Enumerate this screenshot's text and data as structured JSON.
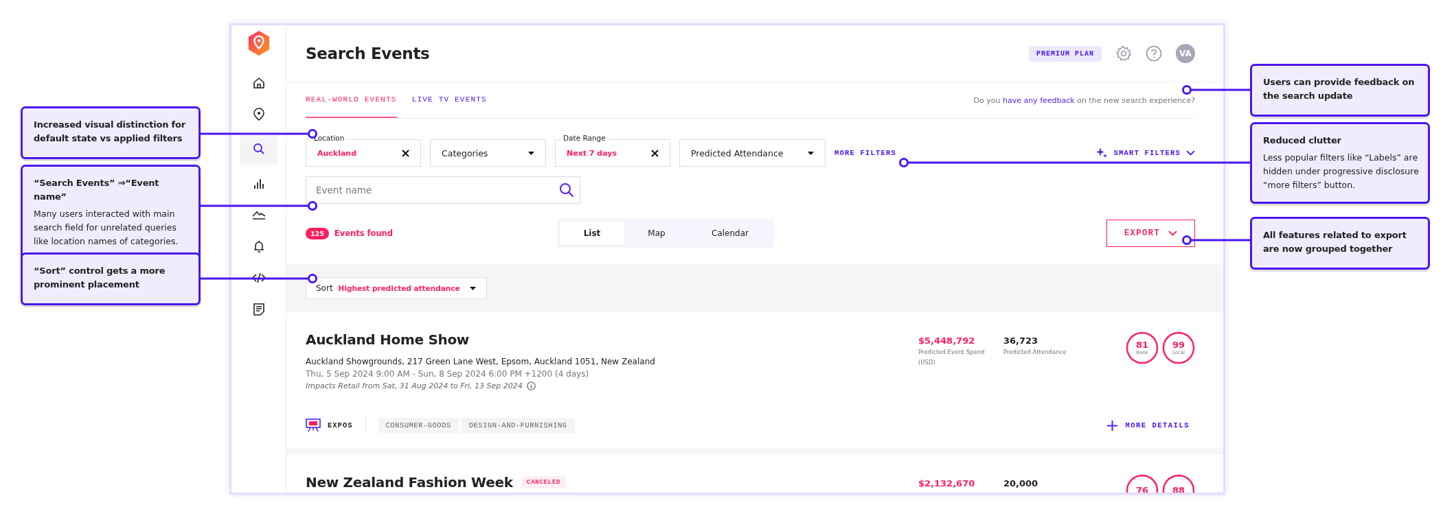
{
  "annotations": {
    "left": [
      {
        "title": "Increased visual distinction for default state vs applied filters"
      },
      {
        "title": "“Search Events” ⇒“Event name”",
        "body": "Many users interacted with main search field for unrelated queries like location names of categories."
      },
      {
        "title": "“Sort” control gets a more prominent placement"
      }
    ],
    "right": [
      {
        "title": "Users can provide feedback on the search update"
      },
      {
        "title": "Reduced clutter",
        "body": "Less popular filters like “Labels” are hidden under progressive disclosure “more filters” button."
      },
      {
        "title": "All features related to export are now grouped together"
      }
    ]
  },
  "sidebar": {
    "items": [
      {
        "selected": false
      },
      {
        "selected": false
      },
      {
        "selected": true
      },
      {
        "selected": false
      },
      {
        "selected": false
      },
      {
        "selected": false
      },
      {
        "selected": false
      },
      {
        "selected": false
      }
    ]
  },
  "header": {
    "title": "Search Events",
    "plan_badge": "PREMIUM PLAN",
    "avatar": "VA"
  },
  "tabs": [
    {
      "label": "REAL-WORLD EVENTS",
      "selected": true
    },
    {
      "label": "LIVE TV EVENTS",
      "selected": false
    }
  ],
  "feedback": {
    "before": "Do you",
    "link": "have any feedback",
    "after": "on the new search experience?"
  },
  "filters": [
    {
      "kind": "applied",
      "label": "Location",
      "value": "Auckland"
    },
    {
      "kind": "dropdown",
      "text": "Categories"
    },
    {
      "kind": "applied",
      "label": "Date Range",
      "value": "Next 7 days"
    },
    {
      "kind": "dropdown",
      "text": "Predicted Attendance"
    }
  ],
  "more_filters": "MORE FILTERS",
  "smart_filters": "SMART FILTERS",
  "search": {
    "placeholder": "Event name"
  },
  "results": {
    "count": "125",
    "label": "Events found"
  },
  "views": [
    {
      "label": "List",
      "selected": true
    },
    {
      "label": "Map",
      "selected": false
    },
    {
      "label": "Calendar",
      "selected": false
    }
  ],
  "export": "EXPORT",
  "sort": {
    "label": "Sort",
    "value": "Highest predicted attendance"
  },
  "events": [
    {
      "title": "Auckland Home Show",
      "address": "Auckland Showgrounds, 217 Green Lane West, Epsom, Auckland 1051, New Zealand",
      "dates": "Thu, 5 Sep 2024 9:00 AM - Sun, 8 Sep 2024 6:00 PM +1200 (4 days)",
      "impact": "Impacts Retail from Sat, 31 Aug 2024 to Fri, 13 Sep 2024",
      "category": "EXPOS",
      "labels": [
        "CONSUMER-GOODS",
        "DESIGN-AND-FURNISHING"
      ],
      "spend": "$5,448,792",
      "spend_label": "Predicted Event Spend (USD)",
      "attendance": "36,723",
      "attendance_label": "Predicted Attendance",
      "scores": [
        {
          "value": "81",
          "label": "Rank"
        },
        {
          "value": "99",
          "label": "Local"
        }
      ],
      "details": "MORE DETAILS"
    },
    {
      "title": "New Zealand Fashion Week",
      "status": "CANCELED",
      "spend": "$2,132,670",
      "attendance": "20,000",
      "scores": [
        {
          "value": "76"
        },
        {
          "value": "88"
        }
      ]
    }
  ]
}
